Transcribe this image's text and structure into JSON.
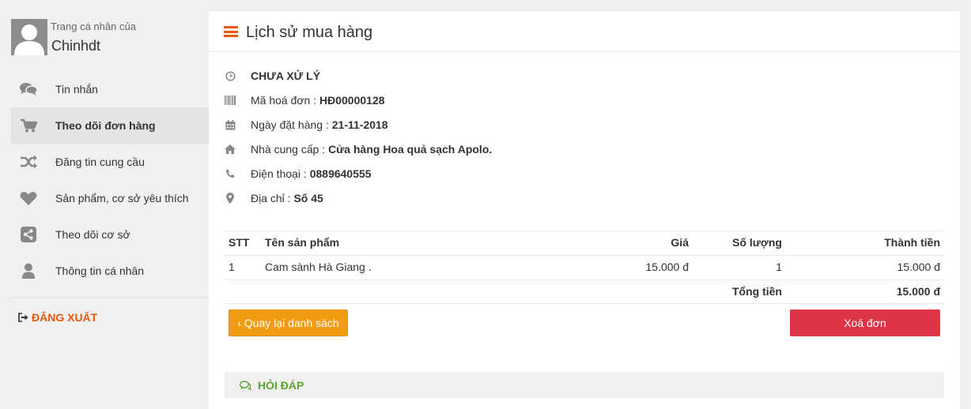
{
  "profile": {
    "caption": "Trang cá nhân của",
    "name": "Chinhdt"
  },
  "menu": {
    "items": [
      {
        "label": "Tin nhắn",
        "icon": "chat-icon"
      },
      {
        "label": "Theo dõi đơn hàng",
        "icon": "cart-icon",
        "active": true
      },
      {
        "label": "Đăng tin cung cầu",
        "icon": "shuffle-icon"
      },
      {
        "label": "Sản phẩm, cơ sở yêu thích",
        "icon": "heart-icon"
      },
      {
        "label": "Theo dõi cơ sở",
        "icon": "share-icon"
      },
      {
        "label": "Thông tin cá nhân",
        "icon": "user-icon"
      }
    ],
    "logout": "ĐĂNG XUẤT"
  },
  "page": {
    "title": "Lịch sử mua hàng"
  },
  "order": {
    "status": "CHƯA XỬ LÝ",
    "invoice_label": "Mã hoá đơn : ",
    "invoice_value": "HĐ00000128",
    "date_label": "Ngày đặt hàng : ",
    "date_value": "21-11-2018",
    "supplier_label": "Nhà cung cấp : ",
    "supplier_value": "Cửa hàng Hoa quả sạch Apolo.",
    "phone_label": "Điện thoại : ",
    "phone_value": "0889640555",
    "address_label": "Địa chỉ : ",
    "address_value": "Số 45"
  },
  "table": {
    "headers": {
      "stt": "STT",
      "name": "Tên sản phẩm",
      "price": "Giá",
      "qty": "Số lượng",
      "total": "Thành tiền"
    },
    "rows": [
      {
        "stt": "1",
        "name": "Cam sành Hà Giang .",
        "price": "15.000 đ",
        "qty": "1",
        "total": "15.000 đ"
      }
    ],
    "sum_label": "Tổng tiền",
    "sum_value": "15.000 đ"
  },
  "actions": {
    "back": "‹ Quay lại danh sách",
    "delete": "Xoá đơn"
  },
  "qa": {
    "label": "HỎI ĐÁP"
  },
  "colors": {
    "accent": "#e8590c",
    "status": "#2f6eb5",
    "back_button": "#f39c12",
    "delete_button": "#dc3545",
    "qa_label": "#5fa332"
  }
}
